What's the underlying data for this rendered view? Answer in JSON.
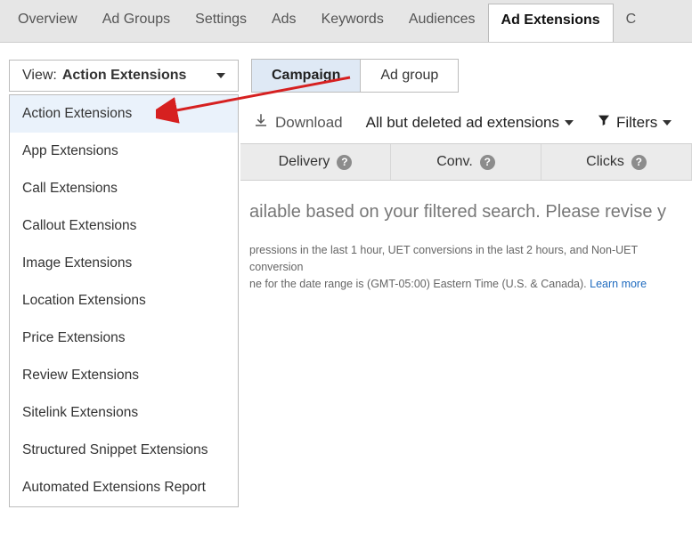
{
  "tabs": {
    "items": [
      {
        "label": "Overview"
      },
      {
        "label": "Ad Groups"
      },
      {
        "label": "Settings"
      },
      {
        "label": "Ads"
      },
      {
        "label": "Keywords"
      },
      {
        "label": "Audiences"
      },
      {
        "label": "Ad Extensions"
      },
      {
        "label": "C"
      }
    ],
    "active_index": 6
  },
  "view_dropdown": {
    "label": "View:",
    "value": "Action Extensions",
    "options": [
      "Action Extensions",
      "App Extensions",
      "Call Extensions",
      "Callout Extensions",
      "Image Extensions",
      "Location Extensions",
      "Price Extensions",
      "Review Extensions",
      "Sitelink Extensions",
      "Structured Snippet Extensions",
      "Automated Extensions Report"
    ],
    "selected_index": 0
  },
  "scope_tabs": {
    "items": [
      "Campaign",
      "Ad group"
    ],
    "active_index": 0
  },
  "toolbar": {
    "download_label": "Download",
    "filter_select_label": "All but deleted ad extensions",
    "filters_label": "Filters"
  },
  "table": {
    "columns": [
      "Delivery",
      "Conv.",
      "Clicks"
    ]
  },
  "content": {
    "empty_message": "ailable based on your filtered search. Please revise y",
    "hint_line1": "pressions in the last 1 hour, UET conversions in the last 2 hours, and Non-UET conversion",
    "hint_line2": "ne for the date range is (GMT-05:00) Eastern Time (U.S. & Canada). ",
    "learn_more": "Learn more"
  }
}
